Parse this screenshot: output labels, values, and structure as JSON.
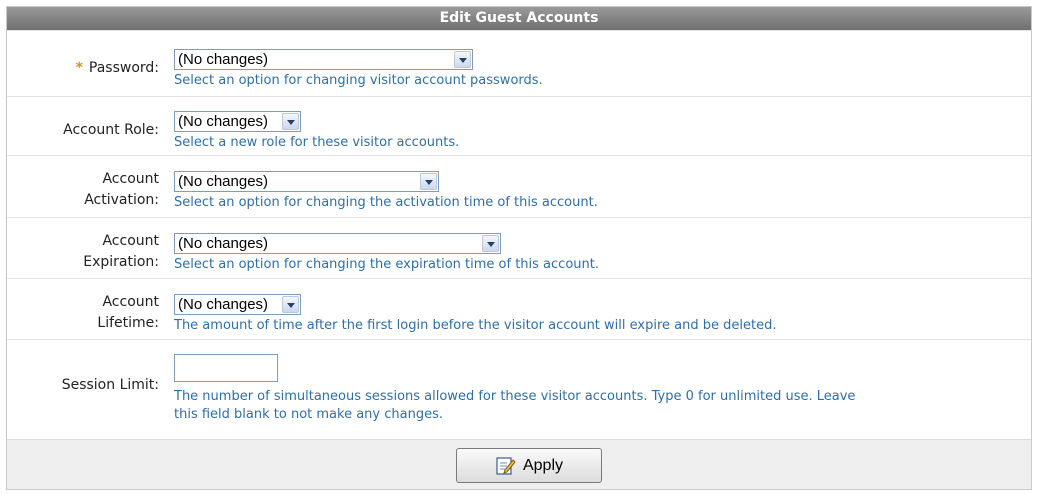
{
  "header": {
    "title": "Edit Guest Accounts"
  },
  "rows": [
    {
      "label_lines": [
        "Password:"
      ],
      "required": "*",
      "select": "(No changes)",
      "help": "Select an option for changing visitor account passwords."
    },
    {
      "label_lines": [
        "Account Role:"
      ],
      "select": "(No changes)",
      "help": "Select a new role for these visitor accounts."
    },
    {
      "label_lines": [
        "Account",
        "Activation:"
      ],
      "select": "(No changes)",
      "help": "Select an option for changing the activation time of this account."
    },
    {
      "label_lines": [
        "Account",
        "Expiration:"
      ],
      "select": "(No changes)",
      "help": "Select an option for changing the expiration time of this account."
    },
    {
      "label_lines": [
        "Account",
        "Lifetime:"
      ],
      "select": "(No changes)",
      "help": "The amount of time after the first login before the visitor account will expire and be deleted."
    },
    {
      "label_lines": [
        "Session Limit:"
      ],
      "input_value": "",
      "help_lines": [
        "The number of simultaneous sessions allowed for these visitor accounts. Type 0 for unlimited use. Leave",
        "this field blank to not make any changes."
      ]
    }
  ],
  "footer": {
    "apply_label": "Apply"
  },
  "icons": {
    "apply": "edit-document-icon",
    "dropdown": "chevron-down-icon"
  },
  "colors": {
    "header": "#808080",
    "help_text": "#2f6ea5",
    "required": "#e48a1e"
  }
}
